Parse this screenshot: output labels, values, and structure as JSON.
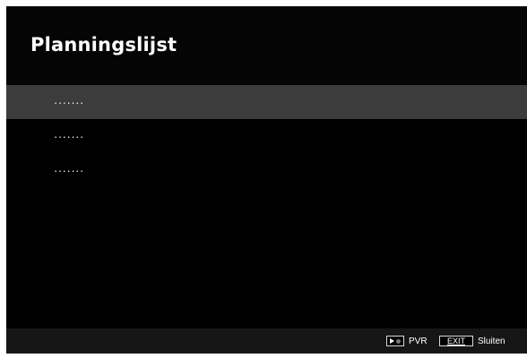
{
  "header": {
    "title": "Planningslijst"
  },
  "list": {
    "items": [
      {
        "label": "·······",
        "selected": true
      },
      {
        "label": "·······",
        "selected": false
      },
      {
        "label": "·······",
        "selected": false
      }
    ]
  },
  "footer": {
    "pvr": {
      "key_icon": "play-record-icon",
      "label": "PVR"
    },
    "exit": {
      "key_label": "EXIT",
      "label": "Sluiten"
    }
  },
  "colors": {
    "background": "#000000",
    "selected_row": "#3c3c3c",
    "footer": "#161616",
    "text": "#ffffff"
  }
}
